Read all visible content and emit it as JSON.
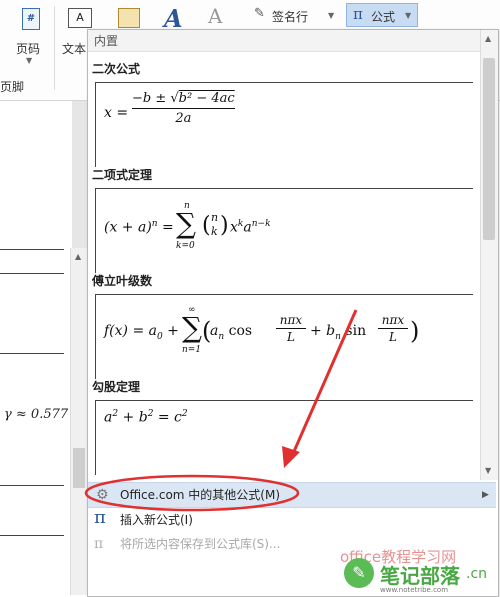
{
  "ribbon": {
    "page_number_label": "页码",
    "text_box_label": "文本",
    "footer_label": "页脚",
    "signature_line_label": "签名行",
    "equation_label": "公式"
  },
  "doc": {
    "gamma_text": "γ ≈ 0.577"
  },
  "gallery": {
    "section_label": "内置",
    "items": [
      {
        "title": "二次公式"
      },
      {
        "title": "二项式定理"
      },
      {
        "title": "傅立叶级数"
      },
      {
        "title": "勾股定理"
      }
    ]
  },
  "menu": {
    "more_office": "Office.com 中的其他公式(M)",
    "insert_new": "插入新公式(I)",
    "save_selection": "将所选内容保存到公式库(S)..."
  },
  "watermark": {
    "line1": "office教程学习网",
    "line2": "笔记部落",
    "suffix": ".cn",
    "url": "www.notetribe.com"
  },
  "colors": {
    "highlight_row": "#dbe6f4",
    "annotation_red": "#e03030"
  }
}
